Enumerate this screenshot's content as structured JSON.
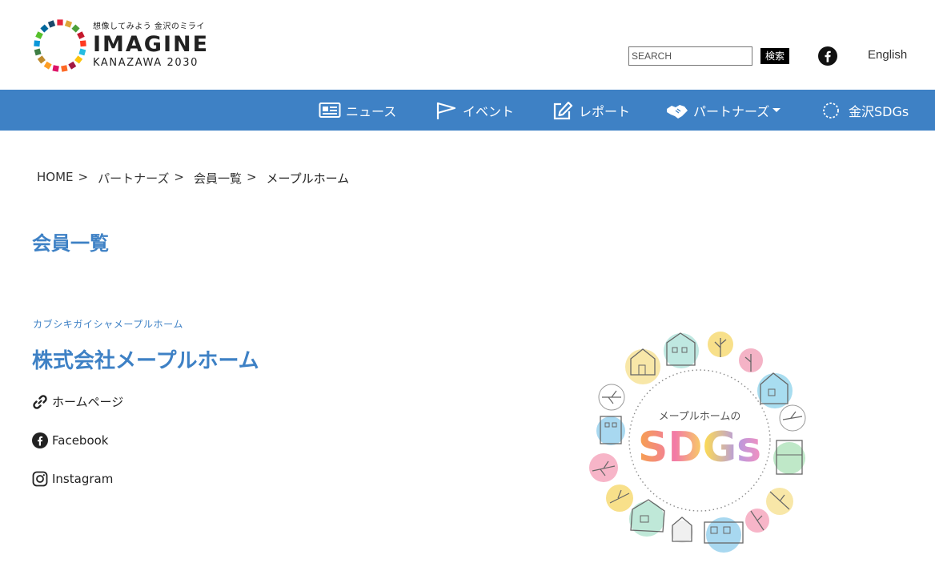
{
  "header": {
    "logo": {
      "tagline": "想像してみよう 金沢のミライ",
      "title": "IMAGINE",
      "subtitle": "KANAZAWA 2030",
      "ring_colors": [
        "#e5243b",
        "#dda63a",
        "#4c9f38",
        "#c5192d",
        "#ff3a21",
        "#26bde2",
        "#fcc30b",
        "#a21942",
        "#fd6925",
        "#dd1367",
        "#fd9d24",
        "#bf8b2e",
        "#3f7e44",
        "#0a97d9",
        "#56c02b",
        "#00689d",
        "#19486a"
      ]
    },
    "search": {
      "placeholder": "SEARCH",
      "button_label": "検索"
    },
    "facebook_icon": "facebook-icon",
    "language_link": "English"
  },
  "nav": {
    "background": "#3e81c5",
    "items": [
      {
        "label": "ニュース",
        "icon": "newspaper-icon"
      },
      {
        "label": "イベント",
        "icon": "flag-icon"
      },
      {
        "label": "レポート",
        "icon": "edit-icon"
      },
      {
        "label": "パートナーズ",
        "icon": "handshake-icon",
        "has_dropdown": true
      },
      {
        "label": "金沢SDGs",
        "icon": "sdgs-ring-icon"
      }
    ]
  },
  "breadcrumb": {
    "items": [
      "HOME",
      "パートナーズ",
      "会員一覧",
      "メープルホーム"
    ],
    "separator": ">"
  },
  "page_title": "会員一覧",
  "company": {
    "kana": "カブシキガイシャメープルホーム",
    "name": "株式会社メープルホーム",
    "links": [
      {
        "label": "ホームページ",
        "icon": "link-icon"
      },
      {
        "label": "Facebook",
        "icon": "facebook-icon"
      },
      {
        "label": "Instagram",
        "icon": "instagram-icon"
      }
    ]
  },
  "sdgs_visual": {
    "caption": "メープルホームの",
    "title": "SDGs"
  },
  "accent_color": "#3e81c5"
}
